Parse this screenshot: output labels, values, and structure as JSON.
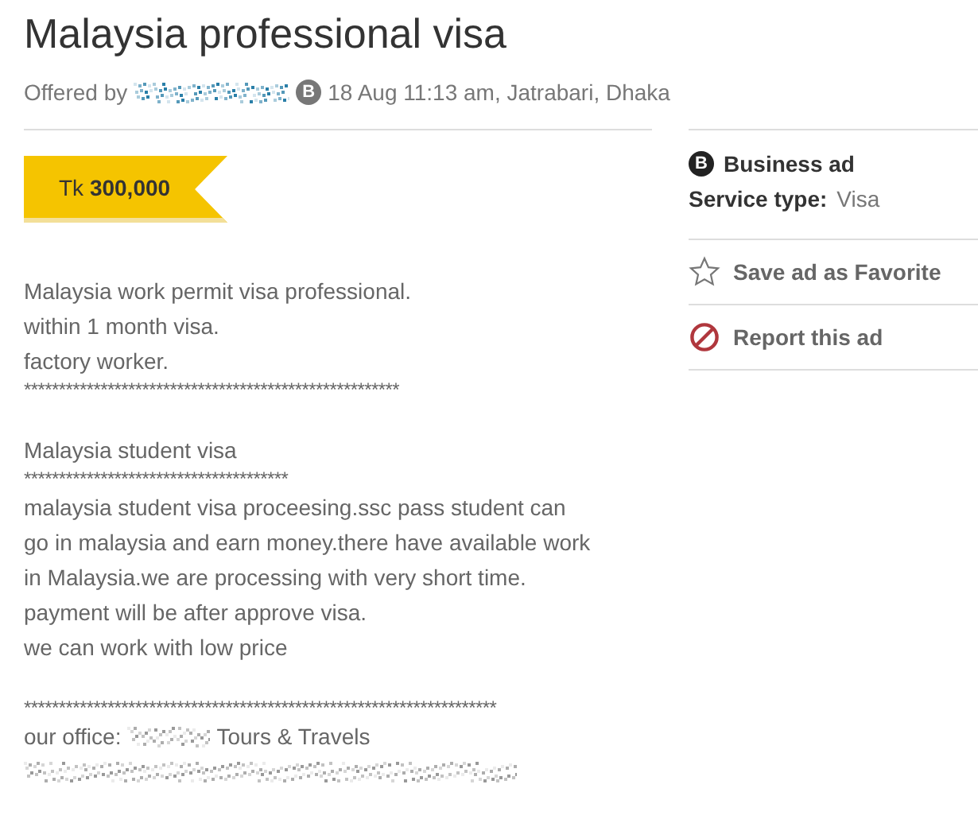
{
  "title": "Malaysia professional visa",
  "meta": {
    "offered_by": "Offered by",
    "badge": "B",
    "posted": "18 Aug 11:13 am, Jatrabari, Dhaka"
  },
  "price": {
    "currency": "Tk",
    "amount": "300,000"
  },
  "description": [
    {
      "kind": "text",
      "text": "Malaysia work permit visa professional."
    },
    {
      "kind": "text",
      "text": "within 1 month visa."
    },
    {
      "kind": "text",
      "text": "factory worker."
    },
    {
      "kind": "stars",
      "text": "******************************************************"
    },
    {
      "kind": "gap"
    },
    {
      "kind": "text",
      "text": "Malaysia student visa"
    },
    {
      "kind": "stars",
      "text": "**************************************"
    },
    {
      "kind": "text",
      "text": "malaysia student visa proceesing.ssc pass student can"
    },
    {
      "kind": "text",
      "text": "go in malaysia and earn money.there have available work"
    },
    {
      "kind": "text",
      "text": "in Malaysia.we are processing with very short time."
    },
    {
      "kind": "text",
      "text": "payment will be after approve visa."
    },
    {
      "kind": "text",
      "text": "we can work with low price"
    },
    {
      "kind": "gap"
    },
    {
      "kind": "stars",
      "text": "********************************************************************"
    },
    {
      "kind": "office",
      "label": "our office:",
      "suffix": "Tours & Travels"
    },
    {
      "kind": "redacted"
    }
  ],
  "sidebar": {
    "badge": "B",
    "ad_type": "Business ad",
    "service_label": "Service type:",
    "service_value": "Visa",
    "actions": [
      {
        "kind": "favorite",
        "label": "Save ad as Favorite"
      },
      {
        "kind": "report",
        "label": "Report this ad"
      }
    ]
  }
}
